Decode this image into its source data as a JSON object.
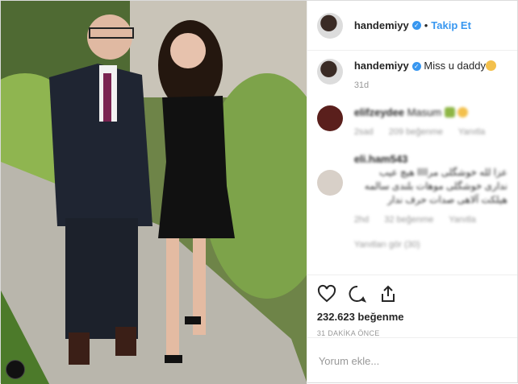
{
  "header": {
    "username": "handemiyy",
    "follow_label": "Takip Et"
  },
  "caption": {
    "username": "handemiyy",
    "text": "Miss u daddy",
    "time": "31d"
  },
  "comments": [
    {
      "username": "elifzeydee",
      "text": "Masum",
      "time": "2sad",
      "likes": "209 beğenme",
      "reply": "Yanıtla"
    },
    {
      "username": "eli.ham543",
      "text": "عزا لله خوشگلی مراااا هیچ عیب نداری خوشگلی موهات بلندی سالمه هیلکت آلاهی صدات حرف ندار",
      "time": "2hd",
      "likes": "32 beğenme",
      "reply": "Yanıtla"
    }
  ],
  "load_more": "Yanıtları gör (30)",
  "actions": {
    "likes": "232.623 beğenme",
    "time": "31 DAKİKA ÖNCE"
  },
  "add_comment": {
    "placeholder": "Yorum ekle..."
  },
  "colors": {
    "accent": "#3897f0"
  }
}
